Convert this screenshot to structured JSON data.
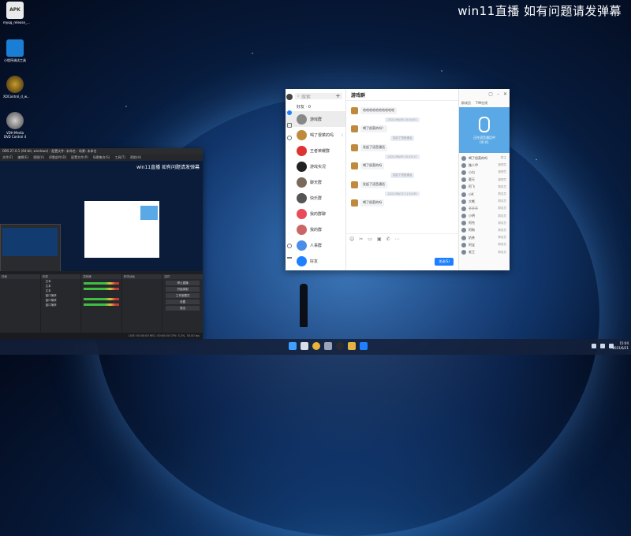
{
  "overlay_text": "win11直播 如有问题请发弹幕",
  "desktop_icons": [
    {
      "label": "myqq_release_..."
    },
    {
      "label": "小程序调试工具"
    },
    {
      "label": "XDControl_d_w..."
    },
    {
      "label": "VDH Media DVD Control 4"
    }
  ],
  "chat": {
    "search_placeholder": "搜索",
    "title": "游戏群",
    "conversations": [
      {
        "name": "好友 · 0",
        "meta": ""
      },
      {
        "name": "游戏群",
        "meta": "",
        "active": true
      },
      {
        "name": "喝了很菜的吗",
        "meta": "2"
      },
      {
        "name": "王者荣耀群",
        "meta": ""
      },
      {
        "name": "游戏实况",
        "meta": ""
      },
      {
        "name": "聊天群",
        "meta": ""
      },
      {
        "name": "快乐群",
        "meta": ""
      },
      {
        "name": "我的群聊",
        "meta": ""
      },
      {
        "name": "我的群",
        "meta": ""
      },
      {
        "name": "人事群",
        "meta": ""
      },
      {
        "name": "好友",
        "meta": ""
      }
    ],
    "messages": [
      {
        "type": "msg",
        "text": "哈哈哈哈哈哈哈哈哈哈"
      },
      {
        "type": "sys",
        "text": "2021/06/08 15:04:01"
      },
      {
        "type": "msg",
        "text": "喝了很菜的吗？"
      },
      {
        "type": "sys",
        "text": "发起了语音通话"
      },
      {
        "type": "msg",
        "text": "发起了语音通话"
      },
      {
        "type": "sys",
        "text": "2021/06/09 10:45:17"
      },
      {
        "type": "msg",
        "text": "喝了很菜的吗"
      },
      {
        "type": "sys",
        "text": "发起了语音通话"
      },
      {
        "type": "msg",
        "text": "发起了语音通话"
      },
      {
        "type": "sys",
        "text": "2021/06/13 11:34:35"
      },
      {
        "type": "msg",
        "text": "喝了很菜的吗"
      }
    ],
    "send_label": "发送(S)",
    "right_tabs": [
      "群成员",
      "TIM在线"
    ],
    "voice_title": "正在语音通话中",
    "voice_sub": "00:01",
    "members": [
      {
        "name": "喝了很菜的吗",
        "role": "群主"
      },
      {
        "name": "路人甲",
        "role": "管理员"
      },
      {
        "name": "小白",
        "role": "管理员"
      },
      {
        "name": "夏天",
        "role": "管理员"
      },
      {
        "name": "阿飞",
        "role": "群成员"
      },
      {
        "name": "小K",
        "role": "群成员"
      },
      {
        "name": "大熊",
        "role": "群成员"
      },
      {
        "name": "不不不",
        "role": "群成员"
      },
      {
        "name": "小明",
        "role": "群成员"
      },
      {
        "name": "阿杰",
        "role": "群成员"
      },
      {
        "name": "阿狗",
        "role": "群成员"
      },
      {
        "name": "奶茶",
        "role": "群成员"
      },
      {
        "name": "阿宝",
        "role": "群成员"
      },
      {
        "name": "老王",
        "role": "群成员"
      },
      {
        "name": "阿华",
        "role": "群成员"
      },
      {
        "name": "小熊",
        "role": "群成员"
      },
      {
        "name": "阿花",
        "role": "群成员"
      },
      {
        "name": "小猪",
        "role": "群成员"
      },
      {
        "name": "小鱼",
        "role": "群成员"
      },
      {
        "name": "人在",
        "role": "群成员"
      },
      {
        "name": "小雨",
        "role": "群成员"
      },
      {
        "name": "阿文",
        "role": "群成员"
      }
    ]
  },
  "obs": {
    "title": "OBS 27.0.1 (64-bit, windows) - 配置文件: 未命名 - 场景: 未命名",
    "menu": [
      "文件(F)",
      "编辑(E)",
      "视图(V)",
      "停靠部件(D)",
      "配置文件(P)",
      "场景集合(S)",
      "工具(T)",
      "帮助(H)"
    ],
    "preview_overlay": "win11直播 如有问题请发弹幕",
    "panels": [
      "场景",
      "来源",
      "混音器",
      "转场动画",
      "控件"
    ],
    "sources": [
      "文本",
      "文本",
      "文本",
      "窗口捕获",
      "窗口捕获",
      "窗口捕获"
    ],
    "controls": [
      "停止直播",
      "开始录制",
      "工作室模式",
      "设置",
      "退出"
    ],
    "status": "LIVE: 00:00:00  REC: 00:00:00  CPU: 5.2%, 30.00 fps"
  },
  "taskbar": {
    "clock_time": "15:04",
    "clock_date": "2021/6/21"
  }
}
